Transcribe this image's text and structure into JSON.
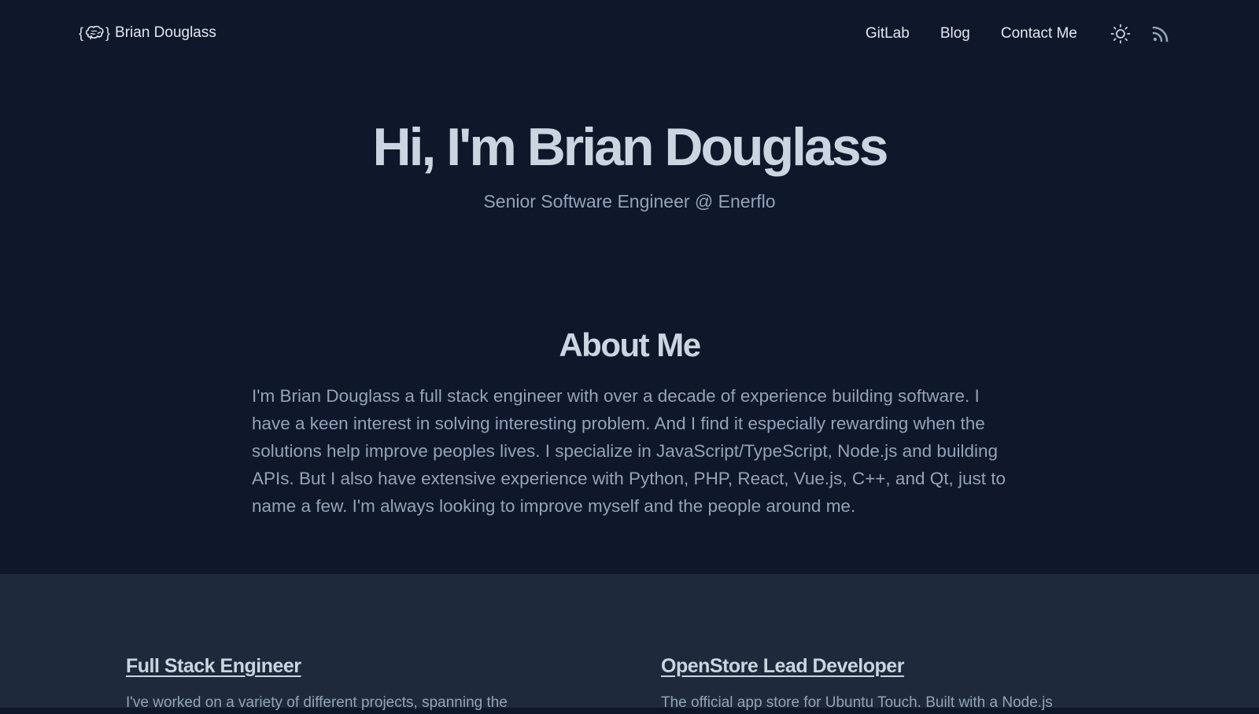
{
  "header": {
    "brand_name": "Brian Douglass",
    "logo_brace_open": "{",
    "logo_brace_close": "}",
    "logo_icon": "brain-icon",
    "nav": [
      {
        "label": "GitLab"
      },
      {
        "label": "Blog"
      },
      {
        "label": "Contact Me"
      }
    ],
    "theme_toggle_icon": "sun-icon",
    "rss_icon": "rss-icon"
  },
  "hero": {
    "title": "Hi, I'm Brian Douglass",
    "subtitle": "Senior Software Engineer @ Enerflo"
  },
  "about": {
    "title": "About Me",
    "text": "I'm Brian Douglass a full stack engineer with over a decade of experience building software. I have a keen interest in solving interesting problem. And I find it especially rewarding when the solutions help improve peoples lives. I specialize in JavaScript/TypeScript, Node.js and building APIs. But I also have extensive experience with Python, PHP, React, Vue.js, C++, and Qt, just to name a few. I'm always looking to improve myself and the people around me."
  },
  "projects": [
    {
      "title": "Full Stack Engineer",
      "description": "I've worked on a variety of different projects, spanning the"
    },
    {
      "title": "OpenStore Lead Developer",
      "description": "The official app store for Ubuntu Touch. Built with a Node.js"
    }
  ],
  "colors": {
    "background": "#0f172a",
    "band": "#1e293b",
    "heading": "#cbd5e1",
    "muted": "#94a3b8"
  }
}
